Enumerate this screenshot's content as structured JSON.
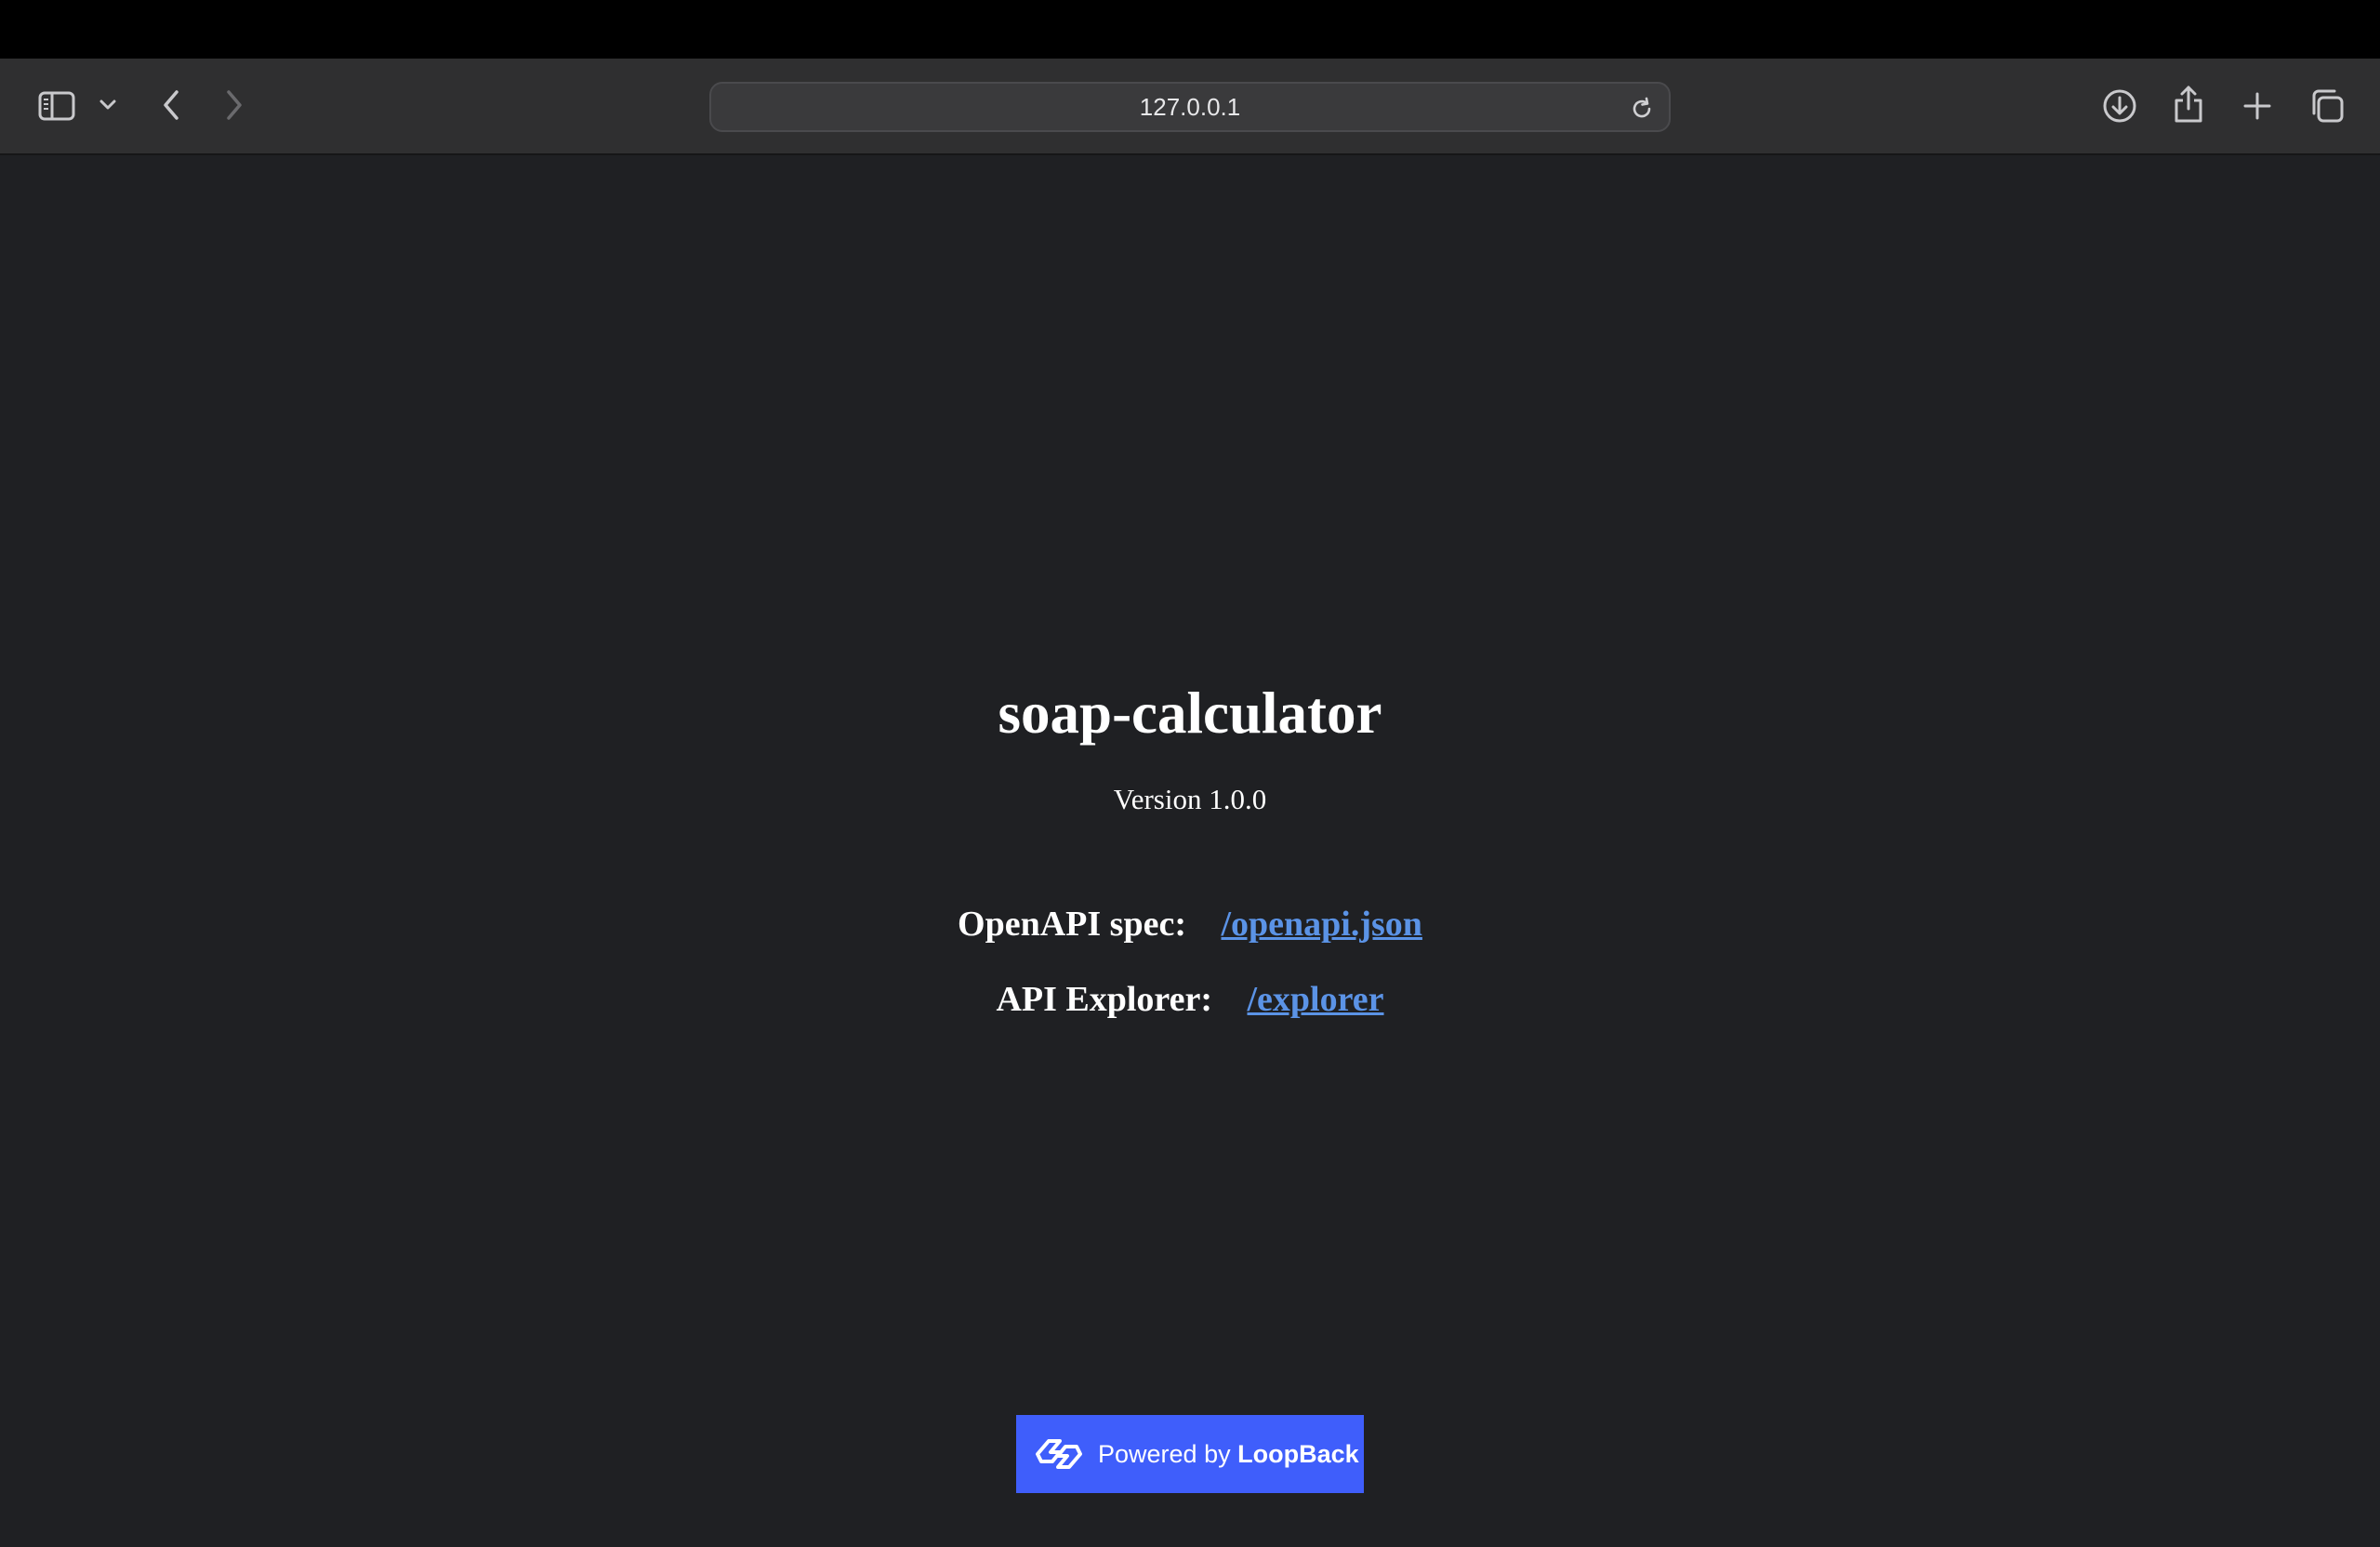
{
  "browser": {
    "url": "127.0.0.1",
    "icons": {
      "sidebar": "sidebar-icon",
      "sidebar_menu": "chevron-down-icon",
      "back": "chevron-left-icon",
      "forward": "chevron-right-icon",
      "reload": "reload-icon",
      "downloads": "download-icon",
      "share": "share-icon",
      "new_tab": "plus-icon",
      "tabs": "tab-overview-icon"
    }
  },
  "page": {
    "title": "soap-calculator",
    "version": "Version 1.0.0",
    "openapi_label": "OpenAPI spec:",
    "openapi_link": "/openapi.json",
    "explorer_label": "API Explorer:",
    "explorer_link": "/explorer",
    "badge_prefix": "Powered by",
    "badge_brand": "LoopBack"
  },
  "colors": {
    "background": "#1f2023",
    "link": "#5b93e6",
    "badge": "#3f5efb",
    "toolbar": "#2f2f30"
  }
}
